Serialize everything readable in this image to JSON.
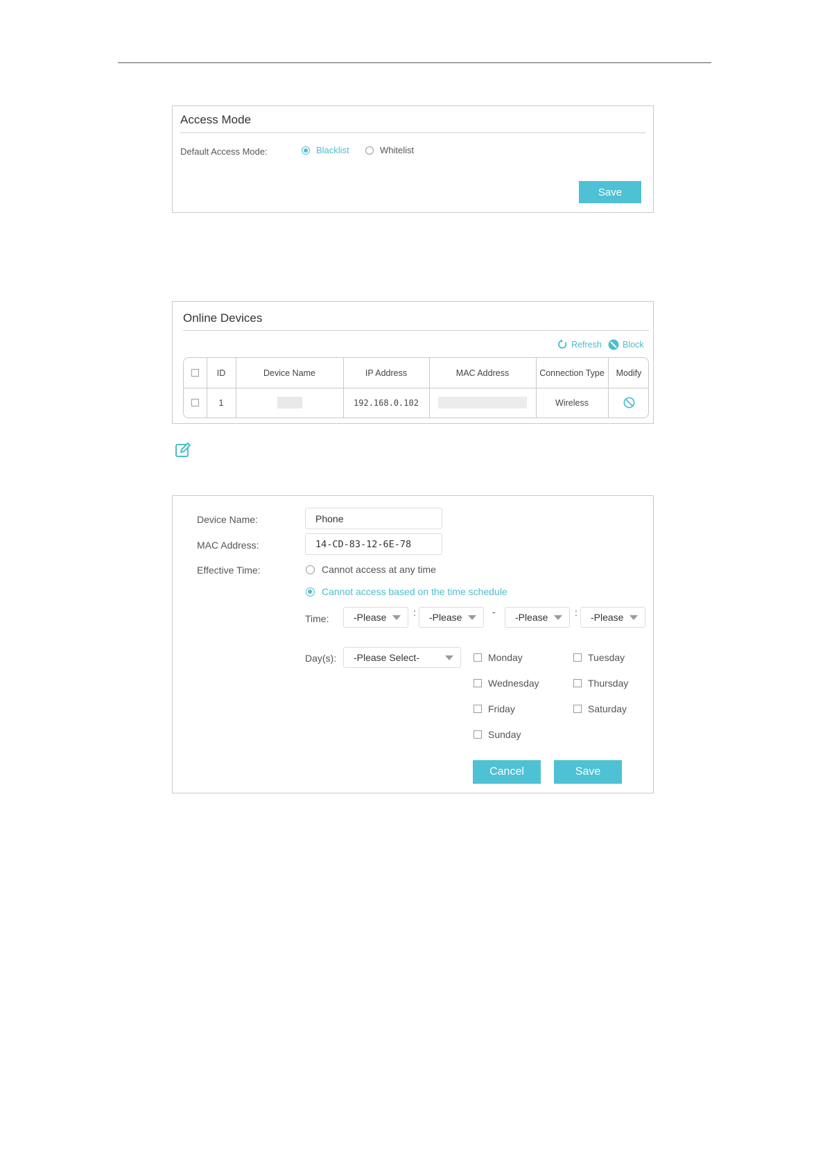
{
  "access_mode": {
    "title": "Access Mode",
    "default_label": "Default Access Mode:",
    "options": [
      {
        "label": "Blacklist",
        "selected": true
      },
      {
        "label": "Whitelist",
        "selected": false
      }
    ],
    "save_label": "Save"
  },
  "online_devices": {
    "title": "Online Devices",
    "refresh_label": "Refresh",
    "block_label": "Block",
    "columns": [
      "ID",
      "Device Name",
      "IP Address",
      "MAC Address",
      "Connection Type",
      "Modify"
    ],
    "rows": [
      {
        "id": "1",
        "device_name": "",
        "ip": "192.168.0.102",
        "mac": "",
        "connection": "Wireless"
      }
    ]
  },
  "edit_form": {
    "device_name_label": "Device Name:",
    "device_name_value": "Phone",
    "mac_label": "MAC Address:",
    "mac_value": "14-CD-83-12-6E-78",
    "effective_time_label": "Effective Time:",
    "effective_options": [
      {
        "label": "Cannot access at any time",
        "selected": false
      },
      {
        "label": "Cannot access based on the time schedule",
        "selected": true
      }
    ],
    "time_label": "Time:",
    "time_selects": [
      "-Please",
      "-Please",
      "-Please",
      "-Please"
    ],
    "time_colon": ":",
    "time_dash": "-",
    "days_label": "Day(s):",
    "days_select": "-Please Select-",
    "days": [
      "Monday",
      "Tuesday",
      "Wednesday",
      "Thursday",
      "Friday",
      "Saturday",
      "Sunday"
    ],
    "cancel_label": "Cancel",
    "save_label": "Save"
  },
  "colors": {
    "accent": "#4ec1d4",
    "border": "#c9c9c9"
  }
}
